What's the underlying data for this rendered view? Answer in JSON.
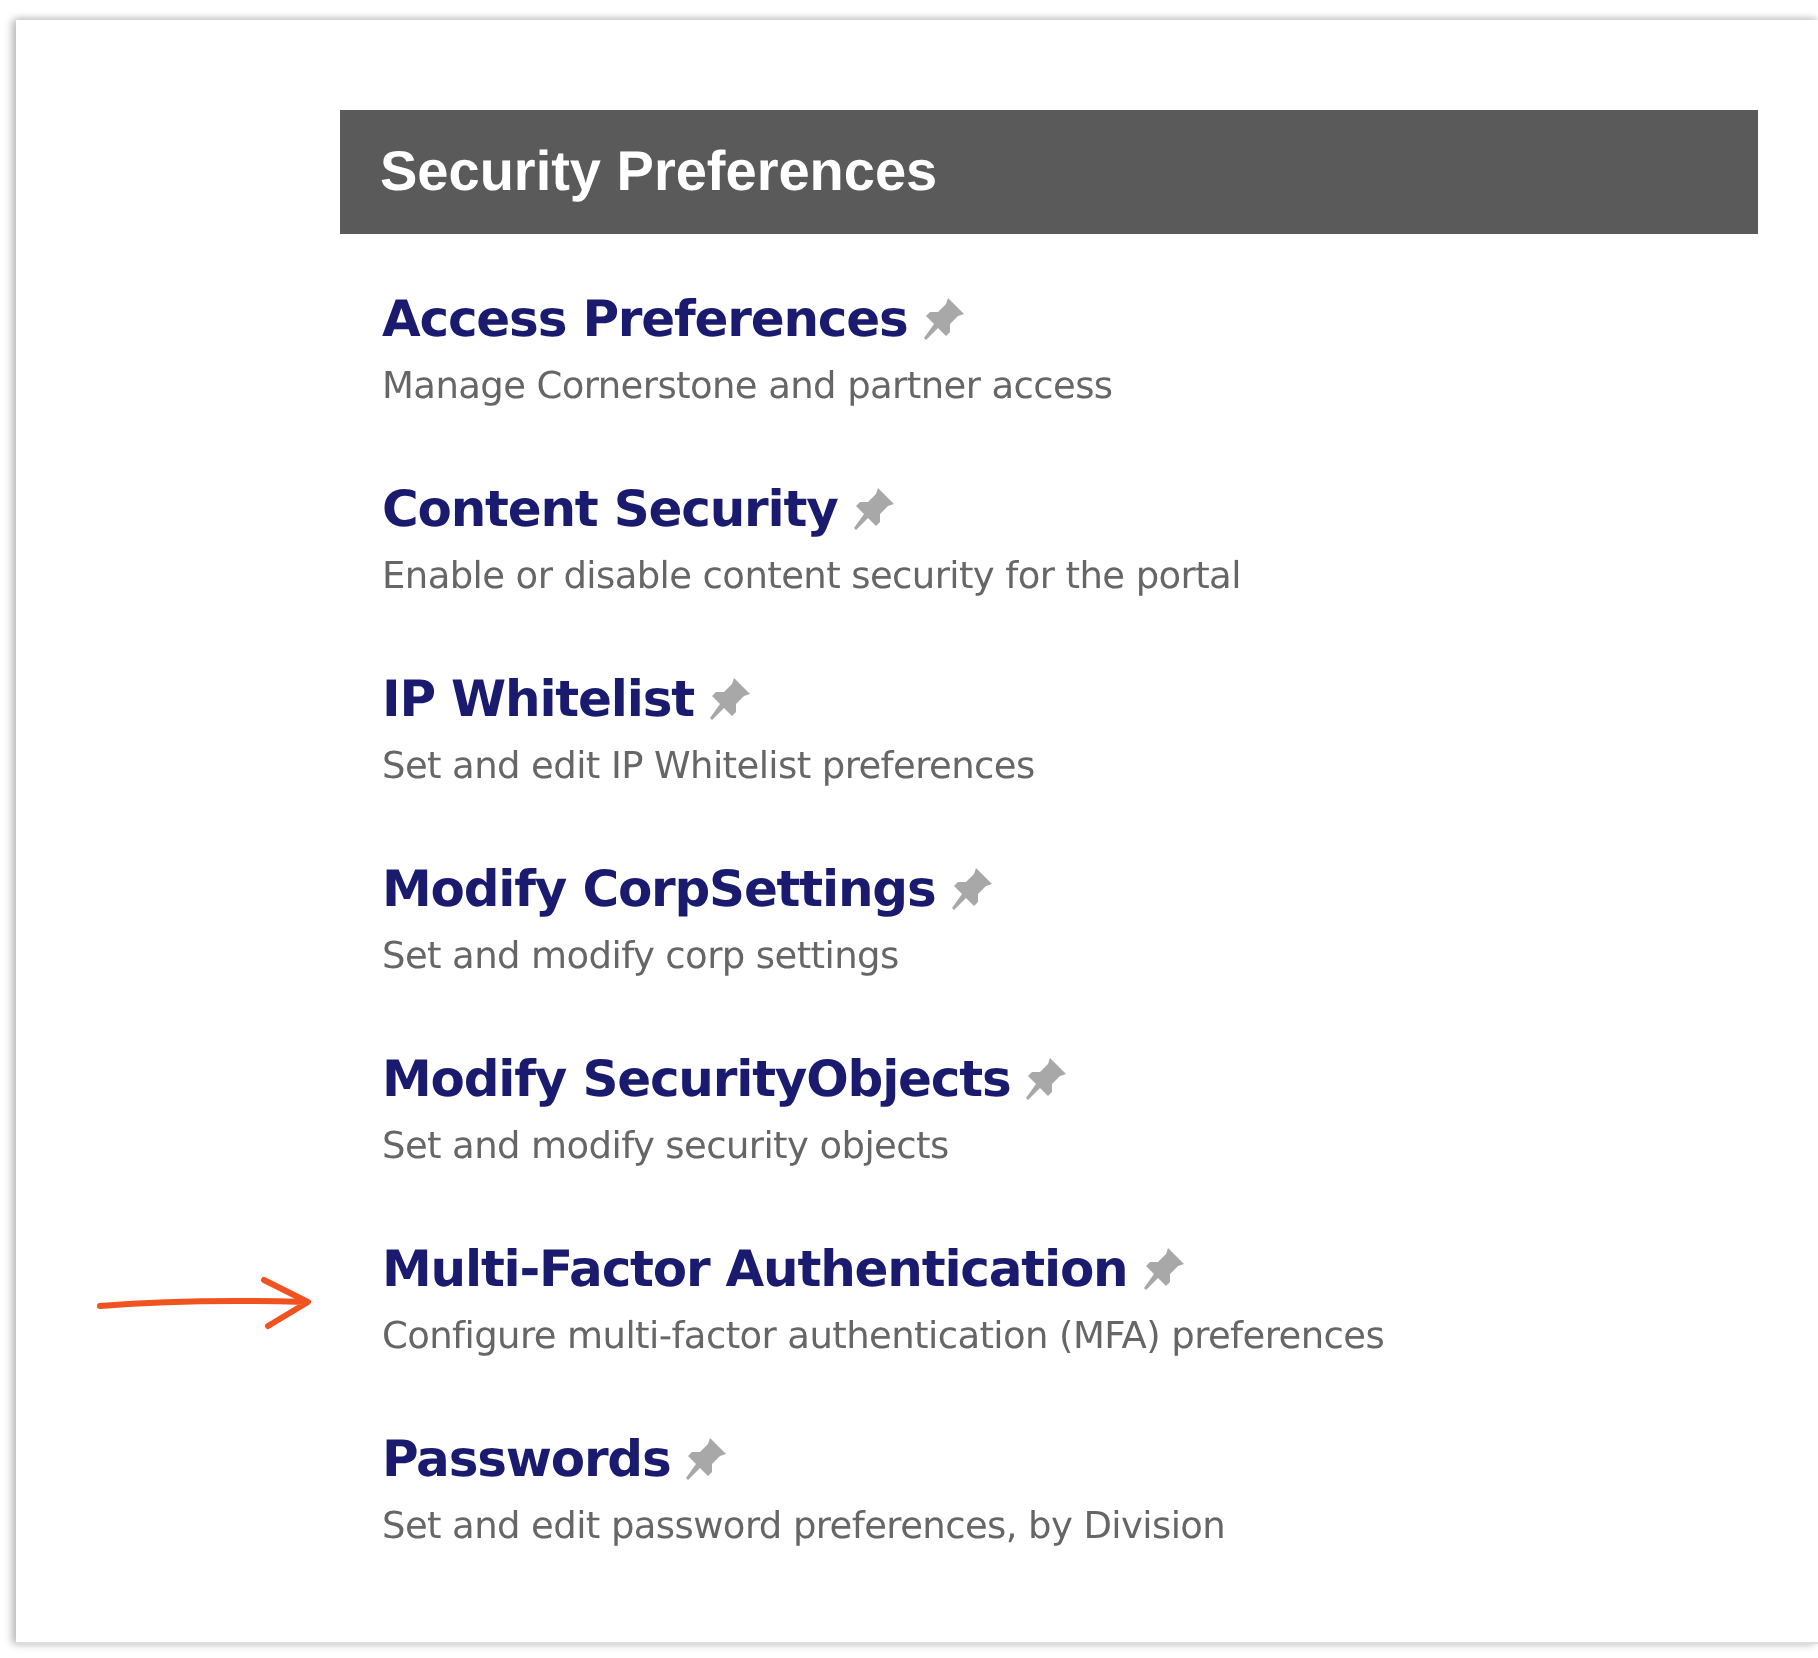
{
  "section": {
    "title": "Security Preferences"
  },
  "items": [
    {
      "title": "Access Preferences",
      "description": "Manage Cornerstone and partner access"
    },
    {
      "title": "Content Security",
      "description": "Enable or disable content security for the portal"
    },
    {
      "title": "IP Whitelist",
      "description": "Set and edit IP Whitelist preferences"
    },
    {
      "title": "Modify CorpSettings",
      "description": "Set and modify corp settings"
    },
    {
      "title": "Modify SecurityObjects",
      "description": "Set and modify security objects"
    },
    {
      "title": "Multi-Factor Authentication",
      "description": "Configure multi-factor authentication (MFA) preferences",
      "marked": true
    },
    {
      "title": "Passwords",
      "description": "Set and edit password preferences, by Division"
    }
  ]
}
